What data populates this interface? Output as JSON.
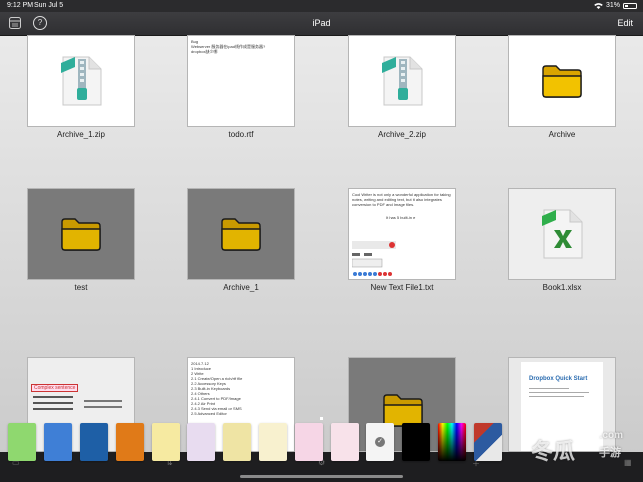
{
  "status": {
    "time": "9:12 PM",
    "date": "Sun Jul 5",
    "battery": "31%",
    "battery_level": 0.31
  },
  "nav": {
    "title": "iPad",
    "edit_label": "Edit",
    "help_label": "?"
  },
  "files": [
    {
      "name": "Archive_1.zip",
      "type": "zip",
      "icon": "zip-file-icon"
    },
    {
      "name": "todo.rtf",
      "type": "rtf",
      "icon": "document-icon",
      "preview": [
        "Bug",
        "Webserver 服务器在ipad线作成是服务器?",
        "dropbox缺少哪",
        ""
      ]
    },
    {
      "name": "Archive_2.zip",
      "type": "zip",
      "icon": "zip-file-icon"
    },
    {
      "name": "Archive",
      "type": "folder",
      "icon": "folder-icon"
    },
    {
      "name": "test",
      "type": "folder",
      "icon": "folder-icon"
    },
    {
      "name": "Archive_1",
      "type": "folder",
      "icon": "folder-icon"
    },
    {
      "name": "New Text File1.txt",
      "type": "txt",
      "icon": "document-icon",
      "preview": [
        "Cool Writer is not only a wonderful application for taking notes, writing and editing text, but it also integrates conversion to PDF and Image files.",
        "",
        "It has 5 built-in e"
      ]
    },
    {
      "name": "Book1.xlsx",
      "type": "xlsx",
      "icon": "excel-file-icon"
    }
  ],
  "row3": {
    "item1_heading": "Complex sentence",
    "item2_preview": [
      "2014.7.12",
      "",
      "1 Introduce",
      "2 Write",
      "2.1 Create/Open a rich/rtf file",
      "2.2 Accessory Keys",
      "2.3 Built-in Keyboards",
      "2.4 Others",
      "2.4.1 Convert to PDF/Image",
      "2.4.2 Air Print",
      "2.4.3 Send via email or SMS",
      "2.5 Advanced Editor"
    ],
    "item4_title": "Dropbox Quick Start"
  },
  "swatches": [
    "#8fd86f",
    "#3f7fd6",
    "#1e5fa6",
    "#e07a18",
    "#f6eaa1",
    "#e8dcf0",
    "#efe4a4",
    "#f8f1cf",
    "#f6d6e6",
    "#f8e2ea",
    "#f4f4f4",
    "#000000",
    "rainbow",
    "photo"
  ],
  "watermark": {
    "big": "冬瓜",
    "small": "手游",
    "domain": ".com"
  }
}
